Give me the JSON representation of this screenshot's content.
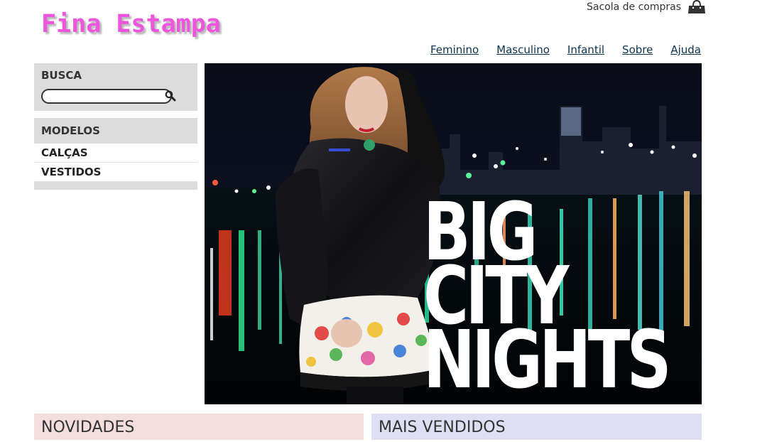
{
  "site": {
    "logo": "Fina Estampa"
  },
  "cart": {
    "label": "Sacola de compras",
    "icon": "shopping-bag-icon"
  },
  "nav": {
    "items": [
      "Feminino",
      "Masculino",
      "Infantil",
      "Sobre",
      "Ajuda"
    ]
  },
  "sidebar": {
    "search_title": "BUSCA",
    "search_value": "",
    "search_icon": "magnifier-icon",
    "categories_title": "MODELOS",
    "categories": [
      "CALÇAS",
      "VESTIDOS"
    ]
  },
  "banner": {
    "headline": [
      "BIG",
      "CITY",
      "NIGHTS"
    ]
  },
  "sections": {
    "left": "NOVIDADES",
    "right": "MAIS VENDIDOS"
  },
  "colors": {
    "logo": "#ee55dd",
    "link": "#0b3350",
    "panel": "#dcdcdc",
    "novidades_bg": "#f3dede",
    "vendidos_bg": "#dedff3"
  }
}
